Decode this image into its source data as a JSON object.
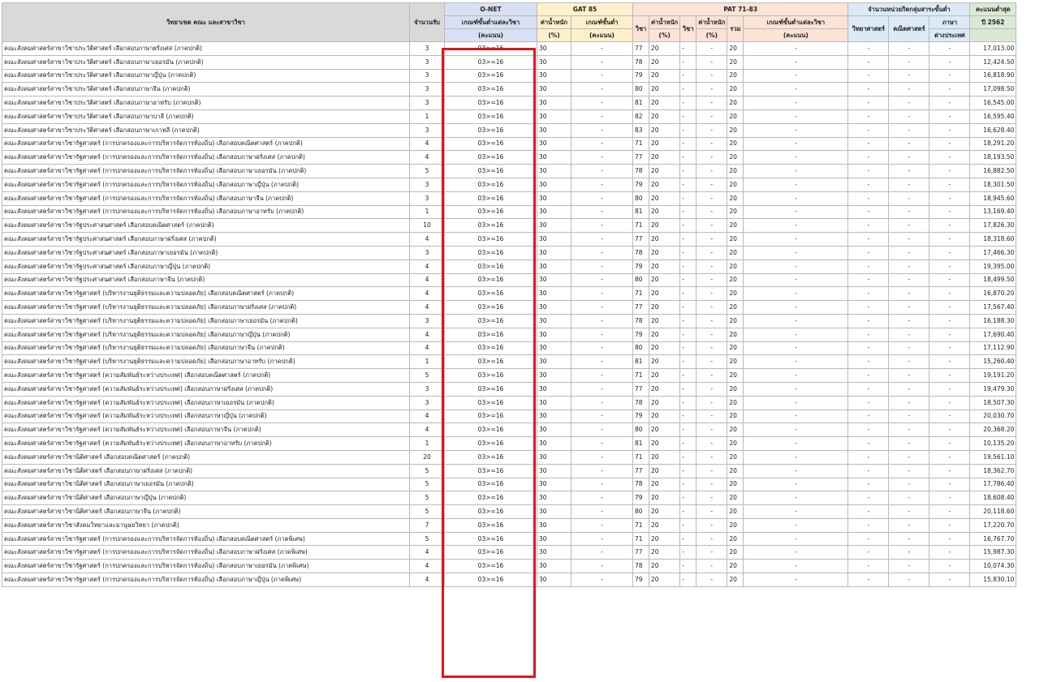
{
  "header": {
    "name": "วิทยาเขต คณะ และสาขาวิชา",
    "count": "จำนวนรับ",
    "onet": "O-NET",
    "onet_min": "เกณฑ์ขั้นต่ำแต่ละวิชา",
    "onet_unit": "(คะแนน)",
    "gat": "GAT 85",
    "gat_weight": "ค่าน้ำหนัก",
    "gat_weight_unit": "(%)",
    "gat_min": "เกณฑ์ขั้นต่ำ",
    "gat_min_unit": "(คะแนน)",
    "pat": "PAT 71-83",
    "pat_subj1": "วิชา",
    "pat_weight1": "ค่าน้ำหนัก",
    "pat_weight1_unit": "(%)",
    "pat_subj2": "วิชา",
    "pat_weight2": "ค่าน้ำหนัก",
    "pat_weight2_unit": "(%)",
    "pat_total": "รวม",
    "pat_min": "เกณฑ์ขั้นต่ำแต่ละวิชา",
    "pat_min_unit": "(คะแนน)",
    "subj": "จำนวนหน่วยกิตกลุ่มสาระขั้นต่ำ",
    "subj_sci": "วิทยาศาสตร์",
    "subj_math": "คณิตศาสตร์",
    "subj_lang1": "ภาษา",
    "subj_lang2": "ต่างประเทศ",
    "min1": "คะแนนต่ำสุด",
    "min2": "ปี 2562"
  },
  "rows": [
    [
      "คณะสังคมศาสตร์สาขาวิชาประวัติศาสตร์ เลือกสอบภาษาฝรั่งเศส (ภาคปกติ)",
      "3",
      "03>=16",
      "30",
      "-",
      "77",
      "20",
      "-",
      "-",
      "20",
      "-",
      "-",
      "-",
      "-",
      "17,013.00"
    ],
    [
      "คณะสังคมศาสตร์สาขาวิชาประวัติศาสตร์ เลือกสอบภาษาเยอรมัน (ภาคปกติ)",
      "3",
      "03>=16",
      "30",
      "-",
      "78",
      "20",
      "-",
      "-",
      "20",
      "-",
      "-",
      "-",
      "-",
      "12,424.50"
    ],
    [
      "คณะสังคมศาสตร์สาขาวิชาประวัติศาสตร์ เลือกสอบภาษาญี่ปุ่น (ภาคปกติ)",
      "3",
      "03>=16",
      "30",
      "-",
      "79",
      "20",
      "-",
      "-",
      "20",
      "-",
      "-",
      "-",
      "-",
      "16,818.90"
    ],
    [
      "คณะสังคมศาสตร์สาขาวิชาประวัติศาสตร์ เลือกสอบภาษาจีน (ภาคปกติ)",
      "3",
      "03>=16",
      "30",
      "-",
      "80",
      "20",
      "-",
      "-",
      "20",
      "-",
      "-",
      "-",
      "-",
      "17,098.50"
    ],
    [
      "คณะสังคมศาสตร์สาขาวิชาประวัติศาสตร์ เลือกสอบภาษาอาหรับ (ภาคปกติ)",
      "3",
      "03>=16",
      "30",
      "-",
      "81",
      "20",
      "-",
      "-",
      "20",
      "-",
      "-",
      "-",
      "-",
      "16,545.00"
    ],
    [
      "คณะสังคมศาสตร์สาขาวิชาประวัติศาสตร์ เลือกสอบภาษาบาลี (ภาคปกติ)",
      "1",
      "03>=16",
      "30",
      "-",
      "82",
      "20",
      "-",
      "-",
      "20",
      "-",
      "-",
      "-",
      "-",
      "16,595.40"
    ],
    [
      "คณะสังคมศาสตร์สาขาวิชาประวัติศาสตร์ เลือกสอบภาษาเกาหลี (ภาคปกติ)",
      "3",
      "03>=16",
      "30",
      "-",
      "83",
      "20",
      "-",
      "-",
      "20",
      "-",
      "-",
      "-",
      "-",
      "16,628.40"
    ],
    [
      "คณะสังคมศาสตร์สาขาวิชารัฐศาสตร์ (การปกครองและการบริหารจัดการท้องถิ่น) เลือกสอบคณิตศาสตร์ (ภาคปกติ)",
      "4",
      "03>=16",
      "30",
      "-",
      "71",
      "20",
      "-",
      "-",
      "20",
      "-",
      "-",
      "-",
      "-",
      "18,291.20"
    ],
    [
      "คณะสังคมศาสตร์สาขาวิชารัฐศาสตร์ (การปกครองและการบริหารจัดการท้องถิ่น) เลือกสอบภาษาฝรั่งเศส (ภาคปกติ)",
      "4",
      "03>=16",
      "30",
      "-",
      "77",
      "20",
      "-",
      "-",
      "20",
      "-",
      "-",
      "-",
      "-",
      "18,193.50"
    ],
    [
      "คณะสังคมศาสตร์สาขาวิชารัฐศาสตร์ (การปกครองและการบริหารจัดการท้องถิ่น) เลือกสอบภาษาเยอรมัน (ภาคปกติ)",
      "5",
      "03>=16",
      "30",
      "-",
      "78",
      "20",
      "-",
      "-",
      "20",
      "-",
      "-",
      "-",
      "-",
      "16,882.50"
    ],
    [
      "คณะสังคมศาสตร์สาขาวิชารัฐศาสตร์ (การปกครองและการบริหารจัดการท้องถิ่น) เลือกสอบภาษาญี่ปุ่น (ภาคปกติ)",
      "3",
      "03>=16",
      "30",
      "-",
      "79",
      "20",
      "-",
      "-",
      "20",
      "-",
      "-",
      "-",
      "-",
      "18,301.50"
    ],
    [
      "คณะสังคมศาสตร์สาขาวิชารัฐศาสตร์ (การปกครองและการบริหารจัดการท้องถิ่น) เลือกสอบภาษาจีน (ภาคปกติ)",
      "3",
      "03>=16",
      "30",
      "-",
      "80",
      "20",
      "-",
      "-",
      "20",
      "-",
      "-",
      "-",
      "-",
      "18,945.60"
    ],
    [
      "คณะสังคมศาสตร์สาขาวิชารัฐศาสตร์ (การปกครองและการบริหารจัดการท้องถิ่น) เลือกสอบภาษาอาหรับ (ภาคปกติ)",
      "1",
      "03>=16",
      "30",
      "-",
      "81",
      "20",
      "-",
      "-",
      "20",
      "-",
      "-",
      "-",
      "-",
      "13,169.40"
    ],
    [
      "คณะสังคมศาสตร์สาขาวิชารัฐประศาสนศาสตร์ เลือกสอบคณิตศาสตร์ (ภาคปกติ)",
      "10",
      "03>=16",
      "30",
      "-",
      "71",
      "20",
      "-",
      "-",
      "20",
      "-",
      "-",
      "-",
      "-",
      "17,826.30"
    ],
    [
      "คณะสังคมศาสตร์สาขาวิชารัฐประศาสนศาสตร์ เลือกสอบภาษาฝรั่งเศส (ภาคปกติ)",
      "4",
      "03>=16",
      "30",
      "-",
      "77",
      "20",
      "-",
      "-",
      "20",
      "-",
      "-",
      "-",
      "-",
      "18,318.60"
    ],
    [
      "คณะสังคมศาสตร์สาขาวิชารัฐประศาสนศาสตร์ เลือกสอบภาษาเยอรมัน (ภาคปกติ)",
      "3",
      "03>=16",
      "30",
      "-",
      "78",
      "20",
      "-",
      "-",
      "20",
      "-",
      "-",
      "-",
      "-",
      "17,466.30"
    ],
    [
      "คณะสังคมศาสตร์สาขาวิชารัฐประศาสนศาสตร์ เลือกสอบภาษาญี่ปุ่น (ภาคปกติ)",
      "4",
      "03>=16",
      "30",
      "-",
      "79",
      "20",
      "-",
      "-",
      "20",
      "-",
      "-",
      "-",
      "-",
      "19,395.00"
    ],
    [
      "คณะสังคมศาสตร์สาขาวิชารัฐประศาสนศาสตร์ เลือกสอบภาษาจีน (ภาคปกติ)",
      "4",
      "03>=16",
      "30",
      "-",
      "80",
      "20",
      "-",
      "-",
      "20",
      "-",
      "-",
      "-",
      "-",
      "18,499.50"
    ],
    [
      "คณะสังคมศาสตร์สาขาวิชารัฐศาสตร์ (บริหารงานยุติธรรมและความปลอดภัย) เลือกสอบคณิตศาสตร์ (ภาคปกติ)",
      "4",
      "03>=16",
      "30",
      "-",
      "71",
      "20",
      "-",
      "-",
      "20",
      "-",
      "-",
      "-",
      "-",
      "16,870.20"
    ],
    [
      "คณะสังคมศาสตร์สาขาวิชารัฐศาสตร์ (บริหารงานยุติธรรมและความปลอดภัย) เลือกสอบภาษาฝรั่งเศส (ภาคปกติ)",
      "4",
      "03>=16",
      "30",
      "-",
      "77",
      "20",
      "-",
      "-",
      "20",
      "-",
      "-",
      "-",
      "-",
      "17,567.40"
    ],
    [
      "คณะสังคมศาสตร์สาขาวิชารัฐศาสตร์ (บริหารงานยุติธรรมและความปลอดภัย) เลือกสอบภาษาเยอรมัน (ภาคปกติ)",
      "3",
      "03>=16",
      "30",
      "-",
      "78",
      "20",
      "-",
      "-",
      "20",
      "-",
      "-",
      "-",
      "-",
      "16,188.30"
    ],
    [
      "คณะสังคมศาสตร์สาขาวิชารัฐศาสตร์ (บริหารงานยุติธรรมและความปลอดภัย) เลือกสอบภาษาญี่ปุ่น (ภาคปกติ)",
      "4",
      "03>=16",
      "30",
      "-",
      "79",
      "20",
      "-",
      "-",
      "20",
      "-",
      "-",
      "-",
      "-",
      "17,690.40"
    ],
    [
      "คณะสังคมศาสตร์สาขาวิชารัฐศาสตร์ (บริหารงานยุติธรรมและความปลอดภัย) เลือกสอบภาษาจีน (ภาคปกติ)",
      "4",
      "03>=16",
      "30",
      "-",
      "80",
      "20",
      "-",
      "-",
      "20",
      "-",
      "-",
      "-",
      "-",
      "17,112.90"
    ],
    [
      "คณะสังคมศาสตร์สาขาวิชารัฐศาสตร์ (บริหารงานยุติธรรมและความปลอดภัย) เลือกสอบภาษาอาหรับ (ภาคปกติ)",
      "1",
      "03>=16",
      "30",
      "-",
      "81",
      "20",
      "-",
      "-",
      "20",
      "-",
      "-",
      "-",
      "-",
      "15,260.40"
    ],
    [
      "คณะสังคมศาสตร์สาขาวิชารัฐศาสตร์ (ความสัมพันธ์ระหว่างประเทศ) เลือกสอบคณิตศาสตร์ (ภาคปกติ)",
      "5",
      "03>=16",
      "30",
      "-",
      "71",
      "20",
      "-",
      "-",
      "20",
      "-",
      "-",
      "-",
      "-",
      "19,191.20"
    ],
    [
      "คณะสังคมศาสตร์สาขาวิชารัฐศาสตร์ (ความสัมพันธ์ระหว่างประเทศ) เลือกสอบภาษาฝรั่งเศส (ภาคปกติ)",
      "3",
      "03>=16",
      "30",
      "-",
      "77",
      "20",
      "-",
      "-",
      "20",
      "-",
      "-",
      "-",
      "-",
      "19,479.30"
    ],
    [
      "คณะสังคมศาสตร์สาขาวิชารัฐศาสตร์ (ความสัมพันธ์ระหว่างประเทศ) เลือกสอบภาษาเยอรมัน (ภาคปกติ)",
      "3",
      "03>=16",
      "30",
      "-",
      "78",
      "20",
      "-",
      "-",
      "20",
      "-",
      "-",
      "-",
      "-",
      "18,507.30"
    ],
    [
      "คณะสังคมศาสตร์สาขาวิชารัฐศาสตร์ (ความสัมพันธ์ระหว่างประเทศ) เลือกสอบภาษาญี่ปุ่น (ภาคปกติ)",
      "4",
      "03>=16",
      "30",
      "-",
      "79",
      "20",
      "-",
      "-",
      "20",
      "-",
      "-",
      "-",
      "-",
      "20,030.70"
    ],
    [
      "คณะสังคมศาสตร์สาขาวิชารัฐศาสตร์ (ความสัมพันธ์ระหว่างประเทศ) เลือกสอบภาษาจีน (ภาคปกติ)",
      "4",
      "03>=16",
      "30",
      "-",
      "80",
      "20",
      "-",
      "-",
      "20",
      "-",
      "-",
      "-",
      "-",
      "20,368.20"
    ],
    [
      "คณะสังคมศาสตร์สาขาวิชารัฐศาสตร์ (ความสัมพันธ์ระหว่างประเทศ) เลือกสอบภาษาอาหรับ (ภาคปกติ)",
      "1",
      "03>=16",
      "30",
      "-",
      "81",
      "20",
      "-",
      "-",
      "20",
      "-",
      "-",
      "-",
      "-",
      "10,135.20"
    ],
    [
      "คณะสังคมศาสตร์สาขาวิชานิติศาสตร์ เลือกสอบคณิตศาสตร์ (ภาคปกติ)",
      "20",
      "03>=16",
      "30",
      "-",
      "71",
      "20",
      "-",
      "-",
      "20",
      "-",
      "-",
      "-",
      "-",
      "19,561.10"
    ],
    [
      "คณะสังคมศาสตร์สาขาวิชานิติศาสตร์ เลือกสอบภาษาฝรั่งเศส (ภาคปกติ)",
      "5",
      "03>=16",
      "30",
      "-",
      "77",
      "20",
      "-",
      "-",
      "20",
      "-",
      "-",
      "-",
      "-",
      "18,362.70"
    ],
    [
      "คณะสังคมศาสตร์สาขาวิชานิติศาสตร์ เลือกสอบภาษาเยอรมัน (ภาคปกติ)",
      "5",
      "03>=16",
      "30",
      "-",
      "78",
      "20",
      "-",
      "-",
      "20",
      "-",
      "-",
      "-",
      "-",
      "17,786.40"
    ],
    [
      "คณะสังคมศาสตร์สาขาวิชานิติศาสตร์ เลือกสอบภาษาญี่ปุ่น (ภาคปกติ)",
      "5",
      "03>=16",
      "30",
      "-",
      "79",
      "20",
      "-",
      "-",
      "20",
      "-",
      "-",
      "-",
      "-",
      "18,608.40"
    ],
    [
      "คณะสังคมศาสตร์สาขาวิชานิติศาสตร์ เลือกสอบภาษาจีน (ภาคปกติ)",
      "5",
      "03>=16",
      "30",
      "-",
      "80",
      "20",
      "-",
      "-",
      "20",
      "-",
      "-",
      "-",
      "-",
      "20,118.60"
    ],
    [
      "คณะสังคมศาสตร์สาขาวิชาสังคมวิทยาและมานุษยวิทยา (ภาคปกติ)",
      "7",
      "03>=16",
      "30",
      "-",
      "71",
      "20",
      "-",
      "-",
      "20",
      "-",
      "-",
      "-",
      "-",
      "17,220.70"
    ],
    [
      "คณะสังคมศาสตร์สาขาวิชารัฐศาสตร์ (การปกครองและการบริหารจัดการท้องถิ่น) เลือกสอบคณิตศาสตร์ (ภาคพิเศษ)",
      "5",
      "03>=16",
      "30",
      "-",
      "71",
      "20",
      "-",
      "-",
      "20",
      "-",
      "-",
      "-",
      "-",
      "16,767.70"
    ],
    [
      "คณะสังคมศาสตร์สาขาวิชารัฐศาสตร์ (การปกครองและการบริหารจัดการท้องถิ่น) เลือกสอบภาษาฝรั่งเศส (ภาคพิเศษ)",
      "4",
      "03>=16",
      "30",
      "-",
      "77",
      "20",
      "-",
      "-",
      "20",
      "-",
      "-",
      "-",
      "-",
      "15,987.30"
    ],
    [
      "คณะสังคมศาสตร์สาขาวิชารัฐศาสตร์ (การปกครองและการบริหารจัดการท้องถิ่น) เลือกสอบภาษาเยอรมัน (ภาคพิเศษ)",
      "4",
      "03>=16",
      "30",
      "-",
      "78",
      "20",
      "-",
      "-",
      "20",
      "-",
      "-",
      "-",
      "-",
      "10,074.30"
    ],
    [
      "คณะสังคมศาสตร์สาขาวิชารัฐศาสตร์ (การปกครองและการบริหารจัดการท้องถิ่น) เลือกสอบภาษาญี่ปุ่น (ภาคพิเศษ)",
      "4",
      "03>=16",
      "30",
      "-",
      "79",
      "20",
      "-",
      "-",
      "20",
      "-",
      "-",
      "-",
      "-",
      "15,830.10"
    ]
  ],
  "colors": {
    "highlight": "#e0141a"
  }
}
